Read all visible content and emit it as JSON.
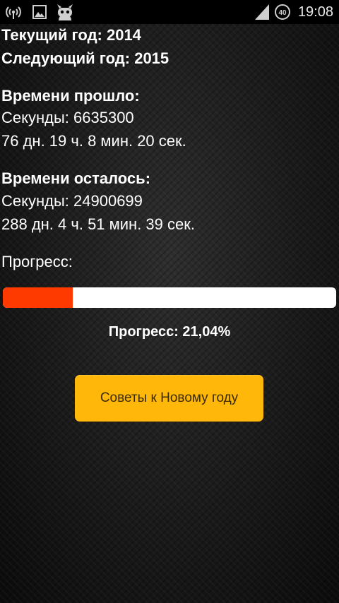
{
  "status_bar": {
    "time": "19:08",
    "battery_level": "40",
    "icons": [
      "wifi-icon",
      "image-icon",
      "android-bot-icon",
      "signal-icon",
      "battery-icon"
    ]
  },
  "info": {
    "current_year": "Текущий год: 2014",
    "next_year": "Следующий год: 2015"
  },
  "elapsed": {
    "heading": "Времени прошло:",
    "seconds": "Секунды: 6635300",
    "breakdown": "76 дн. 19 ч. 8 мин. 20 сек."
  },
  "remaining": {
    "heading": "Времени осталось:",
    "seconds": "Секунды: 24900699",
    "breakdown": "288 дн. 4 ч. 51 мин. 39 сек."
  },
  "progress": {
    "label": "Прогресс:",
    "percent_text": "Прогресс: 21,04%",
    "value": 0.2104,
    "fill_color": "#ff3a00",
    "track_color": "#ffffff"
  },
  "tips_button": {
    "label": "Советы к Новому году",
    "color": "#ffb80a"
  }
}
